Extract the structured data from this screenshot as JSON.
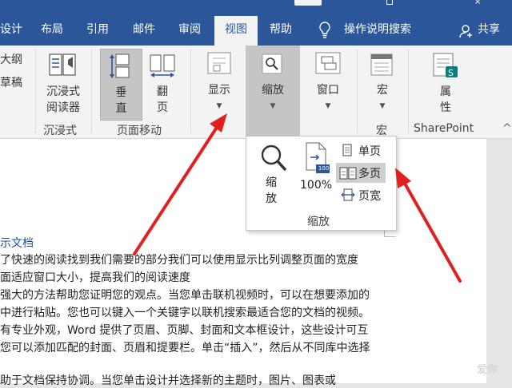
{
  "title_bar": {
    "center_button": "",
    "close": "×"
  },
  "tabs": [
    {
      "label": "设计",
      "name": "tab-design"
    },
    {
      "label": "布局",
      "name": "tab-layout"
    },
    {
      "label": "引用",
      "name": "tab-references"
    },
    {
      "label": "邮件",
      "name": "tab-mailings"
    },
    {
      "label": "审阅",
      "name": "tab-review"
    },
    {
      "label": "视图",
      "name": "tab-view"
    },
    {
      "label": "帮助",
      "name": "tab-help"
    }
  ],
  "tell_me": "操作说明搜索",
  "share": "共享",
  "ribbon": {
    "outline": "大纲",
    "draft": "草稿",
    "immersive_reader_line1": "沉浸式",
    "immersive_reader_line2": "阅读器",
    "immersive_group": "沉浸式",
    "vertical_line1": "垂",
    "vertical_line2": "直",
    "side_line1": "翻",
    "side_line2": "页",
    "page_move_group": "页面移动",
    "show": "显示",
    "zoom": "缩放",
    "window": "窗口",
    "macro": "宏",
    "macro_group": "宏",
    "properties_line1": "属",
    "properties_line2": "性",
    "sharepoint_group": "SharePoint",
    "collapse": "^"
  },
  "zoom_popup": {
    "zoom_line1": "缩",
    "zoom_line2": "放",
    "percent": "100%",
    "percent_badge": "100",
    "one_page": "单页",
    "multi_page": "多页",
    "page_width": "页宽",
    "group_label": "缩放"
  },
  "document": {
    "lines": [
      "示文档",
      "了快速的阅读找到我们需要的部分我们可以使用显示比列调整页面的宽度",
      "面适应窗口大小，提高我们的阅读速度",
      "强大的方法帮助您证明您的观点。当您单击联机视频时，可以在想要添加的",
      "中进行粘贴。您也可以键入一个关键字以联机搜索最适合您的文档的视频。",
      "有专业外观，Word 提供了页眉、页脚、封面和文本框设计，这些设计可互",
      "您可以添加匹配的封面、页眉和提要栏。单击“插入”，然后从不同库中选择",
      "",
      "助于文档保持协调。当您单击设计并选择新的主题时，图片、图表或"
    ],
    "watermark": "爱你"
  },
  "colors": {
    "ribbon_blue": "#2b579a",
    "arrow_red": "#e02020"
  }
}
